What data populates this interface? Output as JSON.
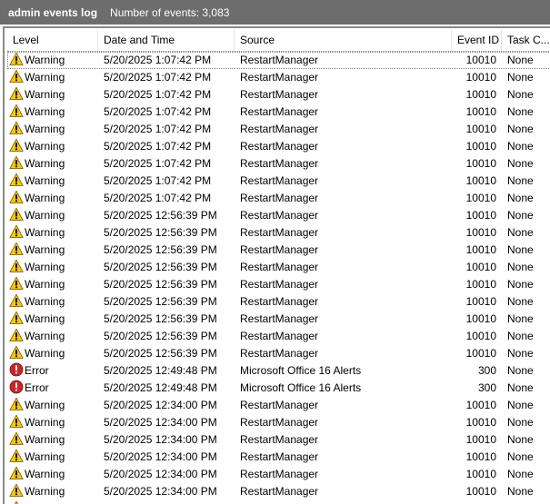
{
  "titlebar": {
    "title": "admin events log",
    "count": "Number of events: 3,083"
  },
  "columns": {
    "level": "Level",
    "date": "Date and Time",
    "source": "Source",
    "event": "Event ID",
    "task": "Task C..."
  },
  "rows": [
    {
      "level": "Warning",
      "date": "5/20/2025 1:07:42 PM",
      "source": "RestartManager",
      "event": "10010",
      "task": "None"
    },
    {
      "level": "Warning",
      "date": "5/20/2025 1:07:42 PM",
      "source": "RestartManager",
      "event": "10010",
      "task": "None"
    },
    {
      "level": "Warning",
      "date": "5/20/2025 1:07:42 PM",
      "source": "RestartManager",
      "event": "10010",
      "task": "None"
    },
    {
      "level": "Warning",
      "date": "5/20/2025 1:07:42 PM",
      "source": "RestartManager",
      "event": "10010",
      "task": "None"
    },
    {
      "level": "Warning",
      "date": "5/20/2025 1:07:42 PM",
      "source": "RestartManager",
      "event": "10010",
      "task": "None"
    },
    {
      "level": "Warning",
      "date": "5/20/2025 1:07:42 PM",
      "source": "RestartManager",
      "event": "10010",
      "task": "None"
    },
    {
      "level": "Warning",
      "date": "5/20/2025 1:07:42 PM",
      "source": "RestartManager",
      "event": "10010",
      "task": "None"
    },
    {
      "level": "Warning",
      "date": "5/20/2025 1:07:42 PM",
      "source": "RestartManager",
      "event": "10010",
      "task": "None"
    },
    {
      "level": "Warning",
      "date": "5/20/2025 1:07:42 PM",
      "source": "RestartManager",
      "event": "10010",
      "task": "None"
    },
    {
      "level": "Warning",
      "date": "5/20/2025 12:56:39 PM",
      "source": "RestartManager",
      "event": "10010",
      "task": "None"
    },
    {
      "level": "Warning",
      "date": "5/20/2025 12:56:39 PM",
      "source": "RestartManager",
      "event": "10010",
      "task": "None"
    },
    {
      "level": "Warning",
      "date": "5/20/2025 12:56:39 PM",
      "source": "RestartManager",
      "event": "10010",
      "task": "None"
    },
    {
      "level": "Warning",
      "date": "5/20/2025 12:56:39 PM",
      "source": "RestartManager",
      "event": "10010",
      "task": "None"
    },
    {
      "level": "Warning",
      "date": "5/20/2025 12:56:39 PM",
      "source": "RestartManager",
      "event": "10010",
      "task": "None"
    },
    {
      "level": "Warning",
      "date": "5/20/2025 12:56:39 PM",
      "source": "RestartManager",
      "event": "10010",
      "task": "None"
    },
    {
      "level": "Warning",
      "date": "5/20/2025 12:56:39 PM",
      "source": "RestartManager",
      "event": "10010",
      "task": "None"
    },
    {
      "level": "Warning",
      "date": "5/20/2025 12:56:39 PM",
      "source": "RestartManager",
      "event": "10010",
      "task": "None"
    },
    {
      "level": "Warning",
      "date": "5/20/2025 12:56:39 PM",
      "source": "RestartManager",
      "event": "10010",
      "task": "None"
    },
    {
      "level": "Error",
      "date": "5/20/2025 12:49:48 PM",
      "source": "Microsoft Office 16 Alerts",
      "event": "300",
      "task": "None"
    },
    {
      "level": "Error",
      "date": "5/20/2025 12:49:48 PM",
      "source": "Microsoft Office 16 Alerts",
      "event": "300",
      "task": "None"
    },
    {
      "level": "Warning",
      "date": "5/20/2025 12:34:00 PM",
      "source": "RestartManager",
      "event": "10010",
      "task": "None"
    },
    {
      "level": "Warning",
      "date": "5/20/2025 12:34:00 PM",
      "source": "RestartManager",
      "event": "10010",
      "task": "None"
    },
    {
      "level": "Warning",
      "date": "5/20/2025 12:34:00 PM",
      "source": "RestartManager",
      "event": "10010",
      "task": "None"
    },
    {
      "level": "Warning",
      "date": "5/20/2025 12:34:00 PM",
      "source": "RestartManager",
      "event": "10010",
      "task": "None"
    },
    {
      "level": "Warning",
      "date": "5/20/2025 12:34:00 PM",
      "source": "RestartManager",
      "event": "10010",
      "task": "None"
    },
    {
      "level": "Warning",
      "date": "5/20/2025 12:34:00 PM",
      "source": "RestartManager",
      "event": "10010",
      "task": "None"
    },
    {
      "level": "Warning",
      "date": "5/20/2025 12:34:00 PM",
      "source": "RestartManager",
      "event": "10010",
      "task": "None"
    }
  ],
  "icons": {
    "Warning": "warning-icon",
    "Error": "error-icon"
  },
  "colors": {
    "titlebar_bg": "#6d6d6d",
    "warning_fill": "#f5c518",
    "error_fill": "#c62828"
  }
}
